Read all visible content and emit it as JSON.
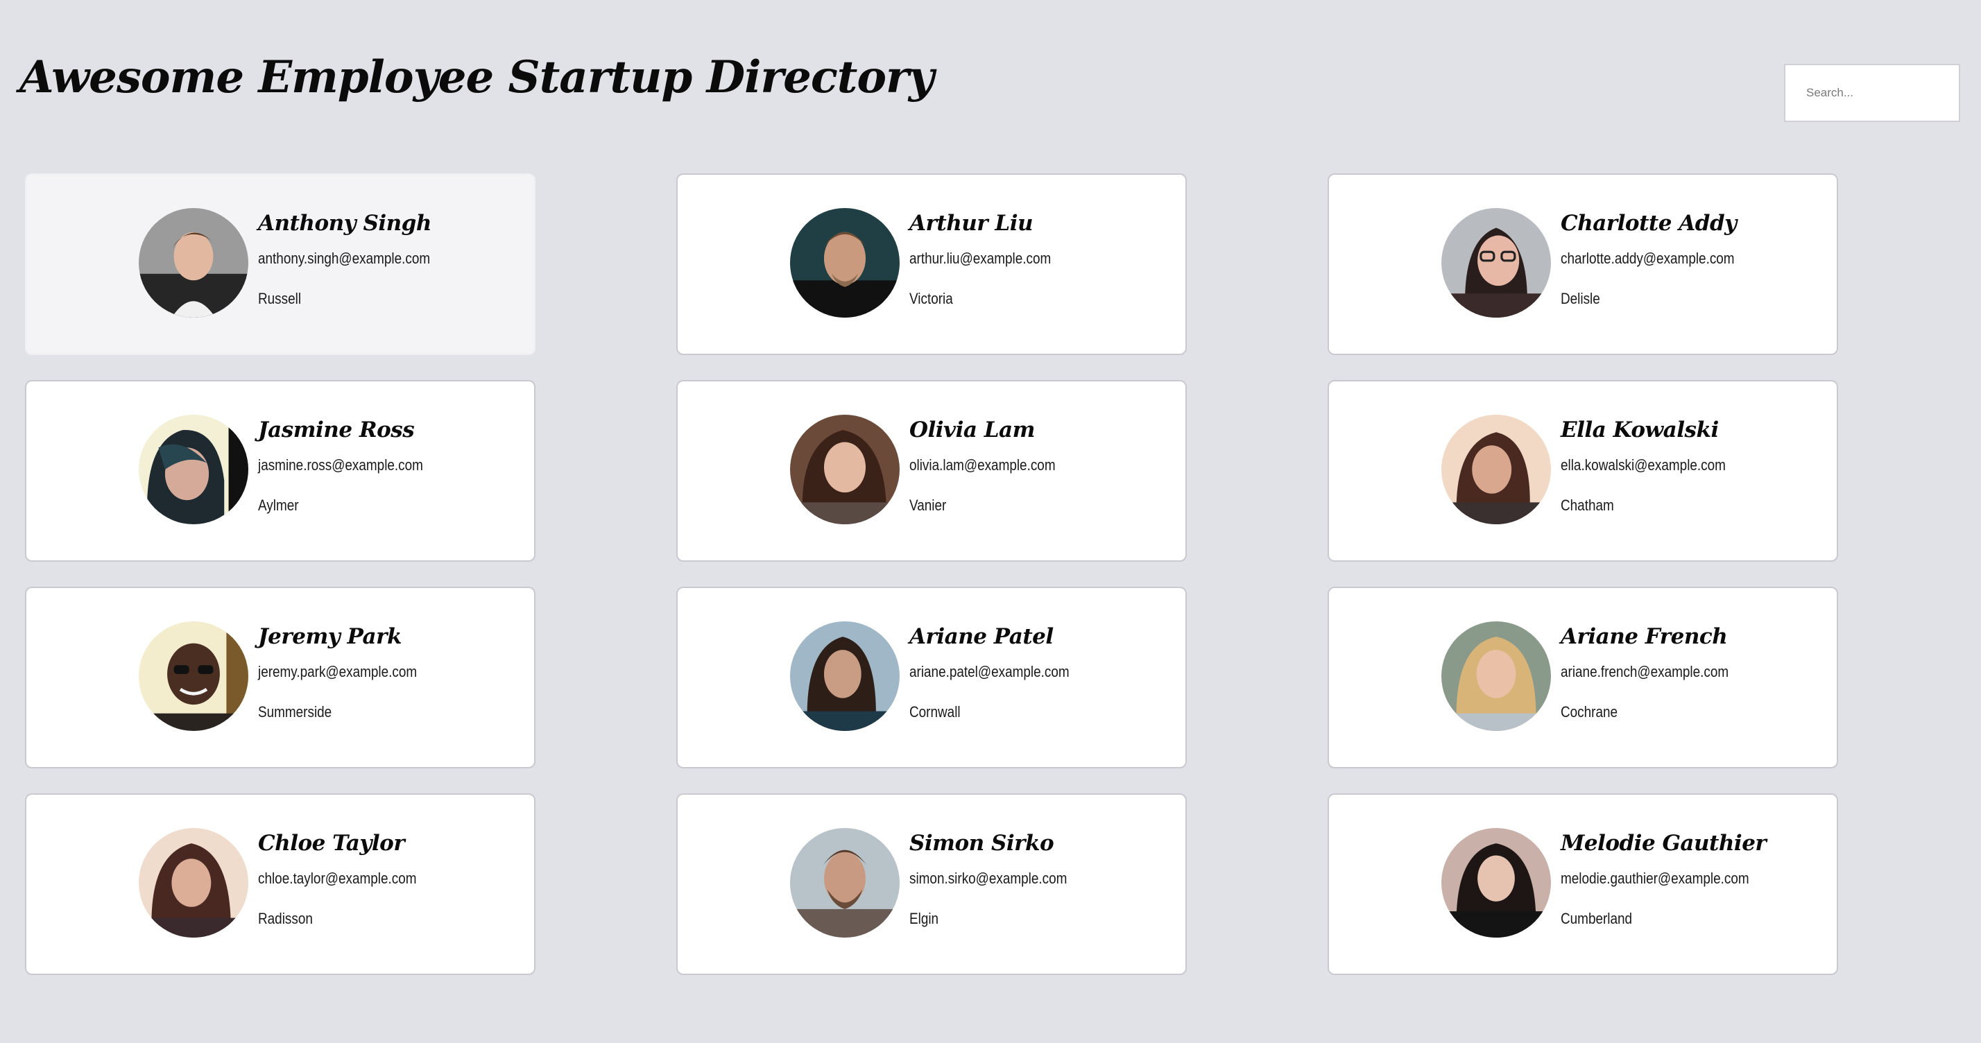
{
  "header": {
    "title": "Awesome Employee Startup Directory",
    "search_placeholder": "Search..."
  },
  "employees": [
    {
      "name": "Anthony Singh",
      "email": "anthony.singh@example.com",
      "city": "Russell",
      "avatar": "photo-anthony-singh"
    },
    {
      "name": "Arthur Liu",
      "email": "arthur.liu@example.com",
      "city": "Victoria",
      "avatar": "photo-arthur-liu"
    },
    {
      "name": "Charlotte Addy",
      "email": "charlotte.addy@example.com",
      "city": "Delisle",
      "avatar": "photo-charlotte-addy"
    },
    {
      "name": "Jasmine Ross",
      "email": "jasmine.ross@example.com",
      "city": "Aylmer",
      "avatar": "photo-jasmine-ross"
    },
    {
      "name": "Olivia Lam",
      "email": "olivia.lam@example.com",
      "city": "Vanier",
      "avatar": "photo-olivia-lam"
    },
    {
      "name": "Ella Kowalski",
      "email": "ella.kowalski@example.com",
      "city": "Chatham",
      "avatar": "photo-ella-kowalski"
    },
    {
      "name": "Jeremy Park",
      "email": "jeremy.park@example.com",
      "city": "Summerside",
      "avatar": "photo-jeremy-park"
    },
    {
      "name": "Ariane Patel",
      "email": "ariane.patel@example.com",
      "city": "Cornwall",
      "avatar": "photo-ariane-patel"
    },
    {
      "name": "Ariane French",
      "email": "ariane.french@example.com",
      "city": "Cochrane",
      "avatar": "photo-ariane-french"
    },
    {
      "name": "Chloe Taylor",
      "email": "chloe.taylor@example.com",
      "city": "Radisson",
      "avatar": "photo-chloe-taylor"
    },
    {
      "name": "Simon Sirko",
      "email": "simon.sirko@example.com",
      "city": "Elgin",
      "avatar": "photo-simon-sirko"
    },
    {
      "name": "Melodie Gauthier",
      "email": "melodie.gauthier@example.com",
      "city": "Cumberland",
      "avatar": "photo-melodie-gauthier"
    }
  ],
  "colors": {
    "page_background": "#e1e1e8",
    "card_background": "#ffffff",
    "card_hover_background": "#f4f4f6",
    "card_border": "#c9c9cf",
    "text": "#0b0b0b"
  }
}
